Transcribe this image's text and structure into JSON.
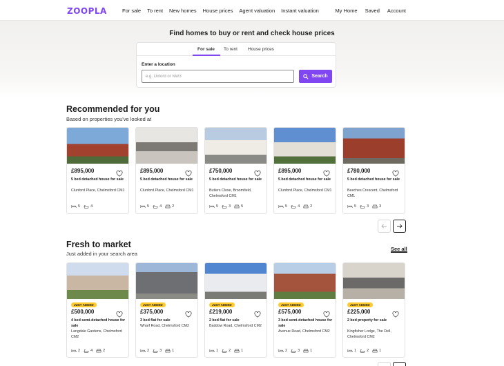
{
  "header": {
    "logo": "ZOOPLA",
    "nav_left": [
      "For sale",
      "To rent",
      "New homes",
      "House prices",
      "Agent valuation",
      "Instant valuation"
    ],
    "nav_right": [
      "My Home",
      "Saved",
      "Account"
    ]
  },
  "hero": {
    "title": "Find homes to buy or rent and check house prices",
    "tabs": [
      "For sale",
      "To rent",
      "House prices"
    ],
    "active_tab": "For sale",
    "location_label": "Enter a location",
    "location_placeholder": "e.g. Oxford or NW3",
    "search_label": "Search"
  },
  "recommended": {
    "title": "Recommended for you",
    "subtitle": "Based on properties you've looked at",
    "cards": [
      {
        "price": "£895,000",
        "desc": "5 bed detached house for sale",
        "addr": "Clunford Place, Chelmsford CM1",
        "beds": "5",
        "baths": "4",
        "receptions": ""
      },
      {
        "price": "£895,000",
        "desc": "5 bed detached house for sale",
        "addr": "Clunford Place, Chelmsford CM1",
        "beds": "5",
        "baths": "4",
        "receptions": "2"
      },
      {
        "price": "£750,000",
        "desc": "5 bed detached house for sale",
        "addr": "Butlers Close, Broomfield, Chelmsford CM1",
        "beds": "5",
        "baths": "3",
        "receptions": "5"
      },
      {
        "price": "£895,000",
        "desc": "5 bed detached house for sale",
        "addr": "Clunford Place, Chelmsford CM1",
        "beds": "5",
        "baths": "4",
        "receptions": "2"
      },
      {
        "price": "£780,000",
        "desc": "5 bed detached house for sale",
        "addr": "Beeches Crescent, Chelmsford CM1",
        "beds": "5",
        "baths": "3",
        "receptions": "3"
      }
    ]
  },
  "fresh": {
    "title": "Fresh to market",
    "subtitle": "Just added in your search area",
    "see_all": "See all",
    "badge": "JUST ADDED",
    "cards": [
      {
        "price": "£500,000",
        "desc": "4 bed semi-detached house for sale",
        "addr": "Langdale Gardens, Chelmsford CM2",
        "beds": "2",
        "baths": "4",
        "receptions": "2"
      },
      {
        "price": "£375,000",
        "desc": "3 bed flat for sale",
        "addr": "Wharf Road, Chelmsford CM2",
        "beds": "2",
        "baths": "3",
        "receptions": "1"
      },
      {
        "price": "£219,000",
        "desc": "2 bed flat for sale",
        "addr": "Baddow Road, Chelmsford CM2",
        "beds": "1",
        "baths": "2",
        "receptions": "1"
      },
      {
        "price": "£575,000",
        "desc": "3 bed semi-detached house for sale",
        "addr": "Avenue Road, Chelmsford CM2",
        "beds": "2",
        "baths": "3",
        "receptions": "1"
      },
      {
        "price": "£225,000",
        "desc": "2 bed property for sale",
        "addr": "Kingfisher Lodge, The Dell, Chelmsford CM2",
        "beds": "1",
        "baths": "2",
        "receptions": "1"
      }
    ]
  },
  "colors": {
    "brand": "#8046f1",
    "badge": "#ffca2c"
  },
  "icons": [
    "search-icon",
    "heart-icon",
    "bed-icon",
    "bath-icon",
    "sofa-icon",
    "arrow-left-icon",
    "arrow-right-icon"
  ]
}
